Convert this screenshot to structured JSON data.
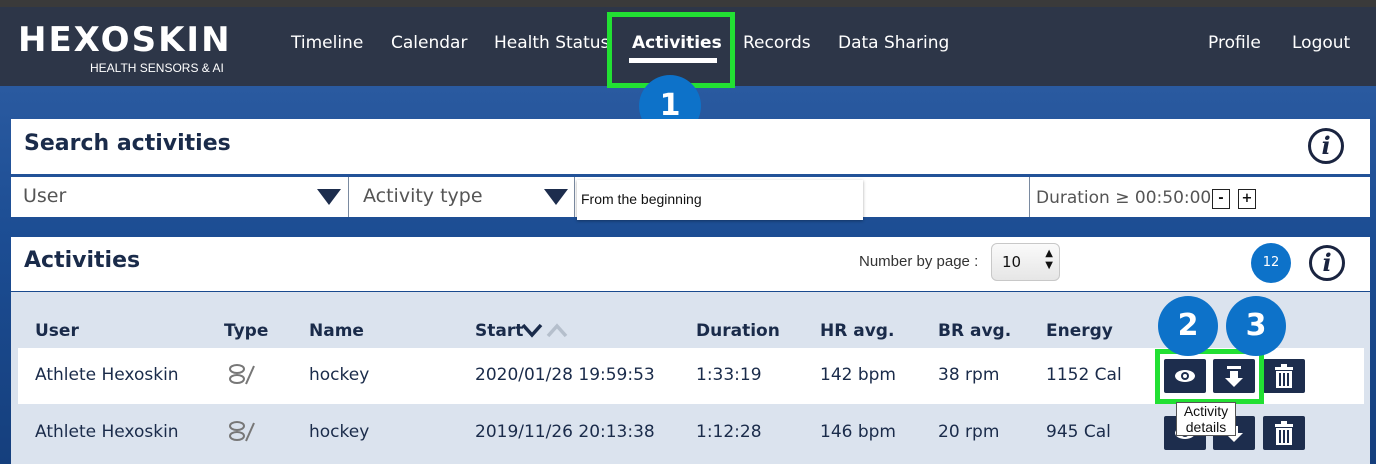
{
  "nav": {
    "logo": "HEXOSKIN",
    "logo_sub": "HEALTH SENSORS & AI",
    "items": [
      {
        "label": "Timeline"
      },
      {
        "label": "Calendar"
      },
      {
        "label": "Health Status"
      },
      {
        "label": "Activities",
        "active": true
      },
      {
        "label": "Records"
      },
      {
        "label": "Data Sharing"
      }
    ],
    "right": [
      {
        "label": "Profile"
      },
      {
        "label": "Logout"
      }
    ]
  },
  "callouts": [
    "1",
    "2",
    "3"
  ],
  "search": {
    "title": "Search activities",
    "info_icon": "i",
    "user_placeholder": "User",
    "activity_type_placeholder": "Activity type",
    "period_value": "From the beginning",
    "duration_text": "Duration ≥ 00:50:00",
    "minus": "-",
    "plus": "+"
  },
  "activities": {
    "title": "Activities",
    "number_by_page_label": "Number by page :",
    "number_by_page_value": "10",
    "count": "12",
    "info_icon": "i",
    "columns": [
      "User",
      "Type",
      "Name",
      "Start",
      "Duration",
      "HR avg.",
      "BR avg.",
      "Energy"
    ],
    "rows": [
      {
        "user": "Athlete Hexoskin",
        "type_icon": "hockey-stick-icon",
        "name": "hockey",
        "start": "2020/01/28 19:59:53",
        "duration": "1:33:19",
        "hr": "142 bpm",
        "br": "38 rpm",
        "energy": "1152 Cal"
      },
      {
        "user": "Athlete Hexoskin",
        "type_icon": "hockey-stick-icon",
        "name": "hockey",
        "start": "2019/11/26 20:13:38",
        "duration": "1:12:28",
        "hr": "146 bpm",
        "br": "20 rpm",
        "energy": "945 Cal"
      }
    ],
    "tooltip": "Activity details"
  },
  "colors": {
    "nav_bg": "#2d3648",
    "highlight": "#22e033",
    "badge": "#0d72c9",
    "action_button": "#1d2d4d"
  }
}
